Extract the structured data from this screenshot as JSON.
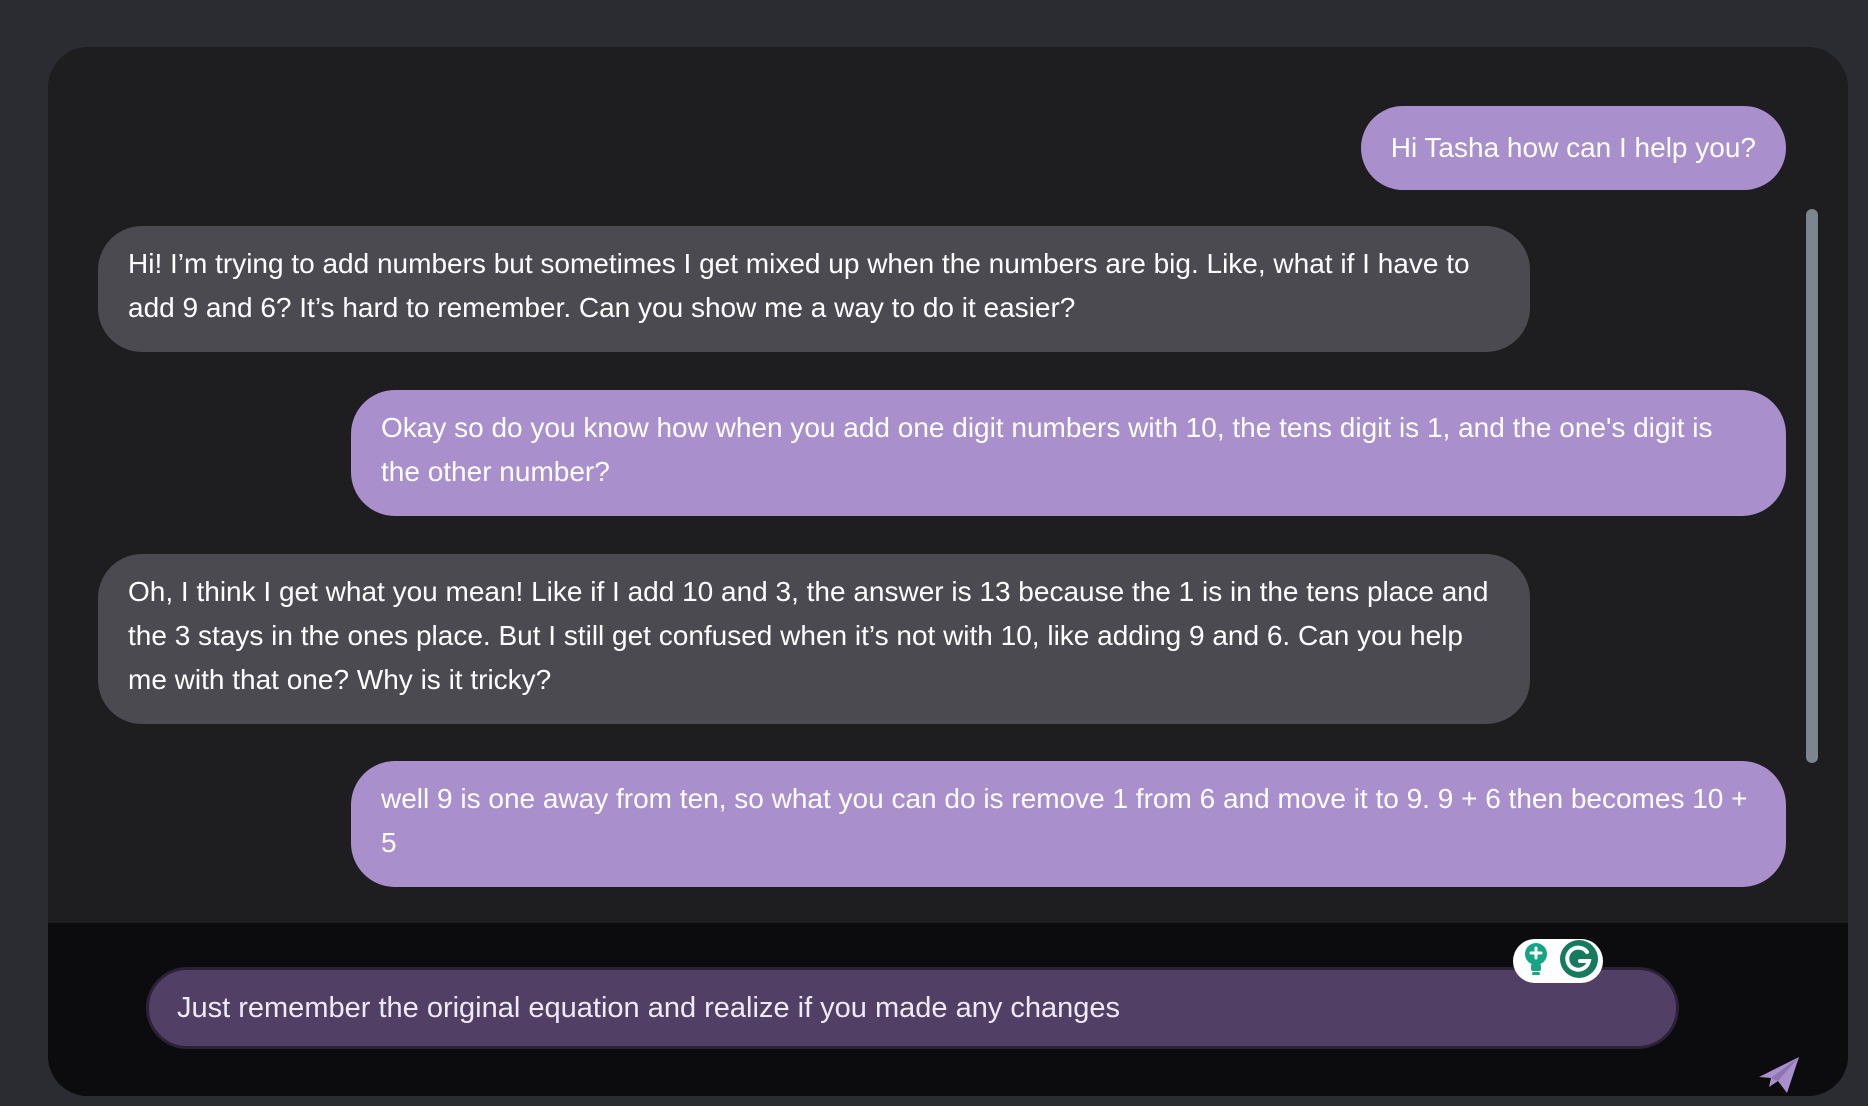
{
  "messages": [
    {
      "role": "user",
      "text": "Hi Tasha how can I help you?"
    },
    {
      "role": "bot",
      "text": "Hi! I’m trying to add numbers but sometimes I get mixed up when the numbers are big. Like, what if I have to add 9 and 6? It’s hard to remember. Can you show me a way to do it easier?"
    },
    {
      "role": "user",
      "text": "Okay so do you know how when you add one digit numbers with 10, the tens digit is 1, and the one's digit is the other number?"
    },
    {
      "role": "bot",
      "text": "Oh, I think I get what you mean! Like if I add 10 and 3, the answer is 13 because the 1 is in the tens place and the 3 stays in the ones place. But I still get confused when it’s not with 10, like adding 9 and 6. Can you help me with that one? Why is it tricky?"
    },
    {
      "role": "user",
      "text": "well 9 is one away from ten, so what you can do is remove 1 from 6 and move it to 9. 9 + 6 then becomes 10 + 5"
    }
  ],
  "composer": {
    "input_value": "Just remember the original equation and realize if you made any changes",
    "send_icon": "paper-plane-icon",
    "extension_icons": [
      "lightbulb-icon",
      "grammarly-icon"
    ]
  },
  "colors": {
    "user_bubble": "#a98fcc",
    "bot_bubble": "#4a4a50",
    "input_background": "#523f65",
    "send_icon": "#a98fcc",
    "page_background": "#2b2c31"
  }
}
